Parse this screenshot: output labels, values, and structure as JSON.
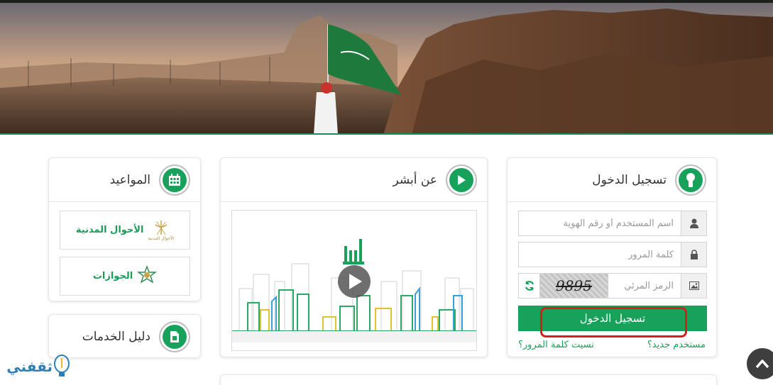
{
  "login": {
    "title": "تسجيل الدخول",
    "username_placeholder": "اسم المستخدم أو رقم الهوية",
    "password_placeholder": "كلمة المرور",
    "captcha_placeholder": "الرمز المرئي",
    "captcha_code": "9895",
    "submit_label": "تسجيل الدخول",
    "new_user_label": "مستخدم جديد؟",
    "forgot_password_label": "نسيت كلمة المرور؟"
  },
  "about": {
    "title": "عن أبشر",
    "logo_text": "أبشر"
  },
  "appointments": {
    "title": "المواعيد",
    "departments": [
      {
        "label": "الأحوال المدنية",
        "sub": "الأحوال المدنية"
      },
      {
        "label": "الجوازات"
      }
    ]
  },
  "services": {
    "title": "دليل الخدمات"
  },
  "watermark": {
    "text": "ثقفني"
  },
  "colors": {
    "brand_green": "#17a15a",
    "highlight_red": "#d81d1d"
  }
}
